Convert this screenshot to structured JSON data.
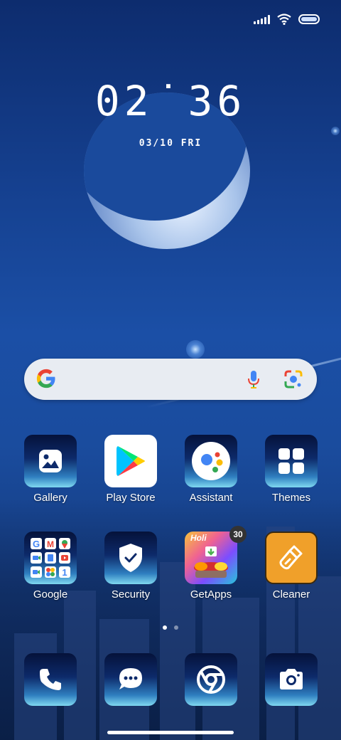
{
  "status_bar": {
    "signal_icon": "signal-icon",
    "wifi_icon": "wifi-icon",
    "battery_icon": "battery-icon"
  },
  "lockscreen_widget": {
    "time": "02:36",
    "date": "03/10 FRI"
  },
  "search_bar": {
    "google_icon": "google-g-icon",
    "mic_icon": "mic-icon",
    "lens_icon": "lens-icon"
  },
  "apps": [
    {
      "label": "Gallery",
      "icon": "gallery-icon"
    },
    {
      "label": "Play Store",
      "icon": "play-store-icon"
    },
    {
      "label": "Assistant",
      "icon": "assistant-icon"
    },
    {
      "label": "Themes",
      "icon": "themes-icon"
    },
    {
      "label": "Google",
      "icon": "google-folder-icon"
    },
    {
      "label": "Security",
      "icon": "security-shield-icon"
    },
    {
      "label": "GetApps",
      "icon": "getapps-icon",
      "badge": "30",
      "badge_text": "Holi"
    },
    {
      "label": "Cleaner",
      "icon": "cleaner-brush-icon"
    }
  ],
  "page_indicator": {
    "count": 2,
    "active": 0
  },
  "dock": [
    {
      "icon": "phone-icon"
    },
    {
      "icon": "messages-icon"
    },
    {
      "icon": "chrome-icon"
    },
    {
      "icon": "camera-icon"
    }
  ],
  "colors": {
    "wallpaper_dark": "#0d2c6e",
    "wallpaper_mid": "#1b4fa6",
    "search_bg": "#e8ecf2",
    "cleaner_orange": "#f0a02a",
    "badge_bg": "#333333"
  }
}
